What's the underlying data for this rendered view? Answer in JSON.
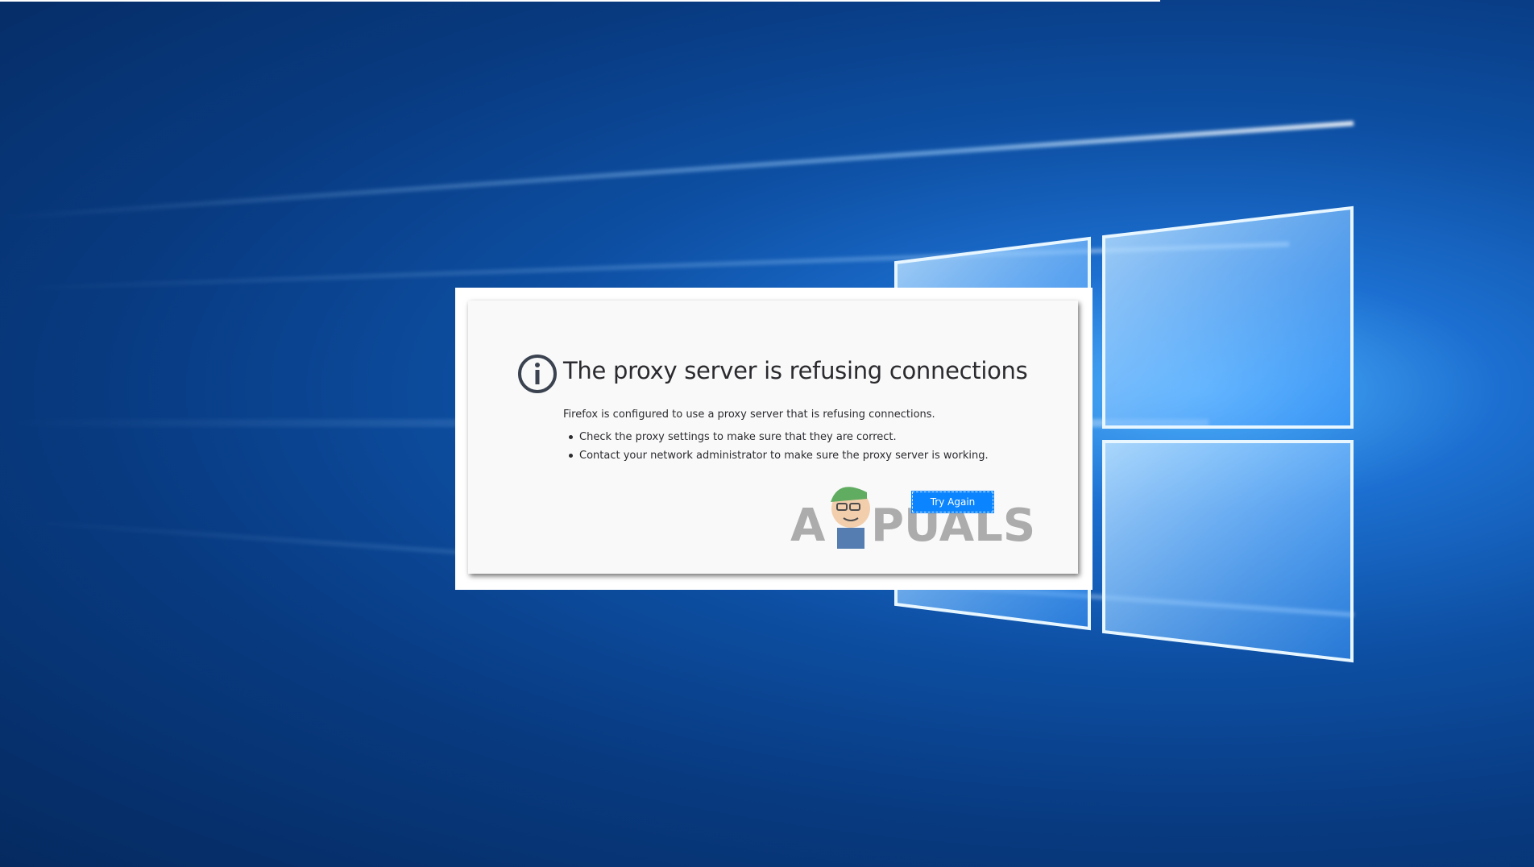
{
  "dialog": {
    "title": "The proxy server is refusing connections",
    "description": "Firefox is configured to use a proxy server that is refusing connections.",
    "bullets": [
      "Check the proxy settings to make sure that they are correct.",
      "Contact your network administrator to make sure the proxy server is working."
    ],
    "try_again_label": "Try Again",
    "icon": "info-icon"
  },
  "watermark": {
    "text": "APPUALS"
  },
  "colors": {
    "accent": "#0a84ff",
    "dialog_bg": "#f9f9fa",
    "text": "#2b2b2f",
    "desktop": "#0d4fa3"
  }
}
